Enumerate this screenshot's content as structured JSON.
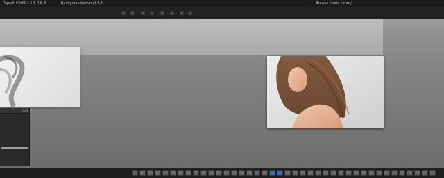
{
  "titlebar": {
    "left_text_1": "PaperMill.tiff",
    "left_text_2": "5.4 5.6 4.8 B",
    "center_text": "Backgroundremoval 4.8",
    "right_text": "Browse photo library"
  },
  "side_panel": {
    "header_label": "tool"
  },
  "toolbar_icons": [
    "tool-icon",
    "tool-icon",
    "tool-icon",
    "tool-icon",
    "tool-icon",
    "tool-icon",
    "tool-icon",
    "tool-icon"
  ],
  "dock_icons": [
    "app-icon",
    "app-icon",
    "app-icon",
    "app-icon",
    "app-icon",
    "app-icon",
    "app-icon",
    "app-icon",
    "app-icon",
    "app-icon",
    "app-icon",
    "app-icon",
    "app-icon",
    "app-icon",
    "app-icon",
    "app-icon",
    "app-icon",
    "app-icon",
    "app-icon",
    "app-icon",
    "app-icon",
    "app-icon",
    "app-icon",
    "app-icon",
    "app-icon",
    "app-icon",
    "app-icon",
    "app-icon",
    "app-icon",
    "app-icon",
    "app-icon",
    "app-icon",
    "app-icon",
    "app-icon",
    "app-icon",
    "app-icon",
    "app-icon",
    "app-icon",
    "app-icon",
    "app-icon"
  ],
  "colors": {
    "workspace": "#7c7c7c",
    "chrome": "#1e1e1e",
    "dock_accent": "#3b6fb0"
  }
}
